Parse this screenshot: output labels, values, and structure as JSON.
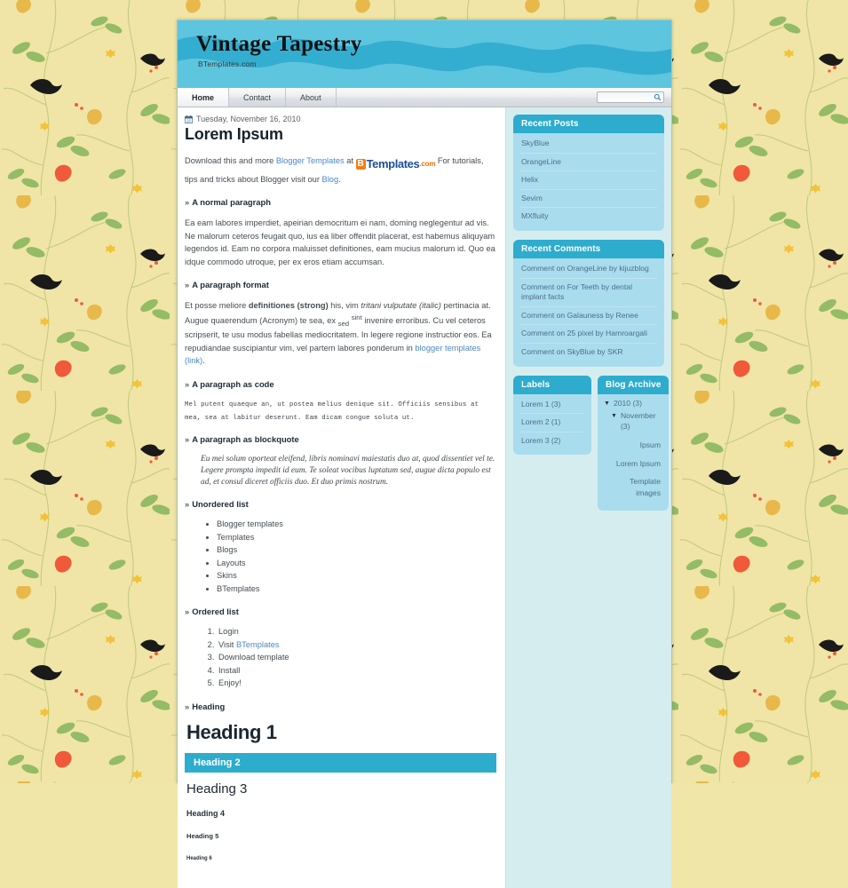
{
  "site": {
    "title": "Vintage Tapestry",
    "description": "BTemplates.com"
  },
  "nav": {
    "tabs": [
      {
        "label": "Home",
        "active": true
      },
      {
        "label": "Contact",
        "active": false
      },
      {
        "label": "About",
        "active": false
      }
    ],
    "search": {
      "value": "",
      "placeholder": "",
      "icon": "search-icon"
    }
  },
  "post": {
    "date": "Tuesday, November 16, 2010",
    "date_icon": "calendar-icon",
    "title": "Lorem Ipsum",
    "intro_before_link": "Download this and more ",
    "intro_link": "Blogger Templates",
    "intro_at": " at ",
    "logo": {
      "b": "B",
      "name": "Templates",
      "com": ".com"
    },
    "intro_after_logo": " For tutorials, tips and tricks about Blogger visit our ",
    "intro_blog_link": "Blog",
    "intro_end": ".",
    "sections": {
      "normal_paragraph_heading": "A normal paragraph",
      "normal_paragraph_text": "Ea eam labores imperdiet, apeirian democritum ei nam, doming neglegentur ad vis. Ne malorum ceteros feugait quo, ius ea liber offendit placerat, est habemus aliquyam legendos id. Eam no corpora maluisset definitiones, eam mucius malorum id. Quo ea idque commodo utroque, per ex eros etiam accumsan.",
      "format_heading": "A paragraph format",
      "format_p1": "Et posse meliore ",
      "format_strong": "definitiones (strong)",
      "format_p2": " his, vim ",
      "format_italic": "tritani vulputate (italic)",
      "format_p3": " pertinacia at. Augue quaerendum (Acronym) te sea, ex ",
      "format_sub": "sed",
      "format_sup": "sint",
      "format_strike": "invenire erroribus",
      "format_p4": ". Cu vel ceteros scripserit, te usu modus fabellas mediocritatem. In legere regione instructior eos. Ea repudiandae suscipiantur vim, vel partem labores ponderum in ",
      "format_link": "blogger templates (link)",
      "format_end": ".",
      "code_heading": "A paragraph as code",
      "code_text": "Mel putent quaeque an, ut postea melius denique sit. Officiis sensibus at mea, sea at labitur deserunt. Eam dicam congue soluta ut.",
      "blockquote_heading": "A paragraph as blockquote",
      "blockquote_text": "Eu mei solum oporteat eleifend, libris nominavi maiestatis duo at, quod dissentiet vel te. Legere prompta impedit id eum. Te soleat vocibus luptatum sed, augue dicta populo est ad, et consul diceret officiis duo. Et duo primis nostrum.",
      "unordered_heading": "Unordered list",
      "unordered_items": [
        "Blogger templates",
        "Templates",
        "Blogs",
        "Layouts",
        "Skins",
        "BTemplates"
      ],
      "ordered_heading": "Ordered list",
      "ordered_items": [
        {
          "text": "Login",
          "link": ""
        },
        {
          "text": "Visit ",
          "link": "BTemplates"
        },
        {
          "text": "Download template",
          "link": ""
        },
        {
          "text": "Install",
          "link": ""
        },
        {
          "text": "Enjoy!",
          "link": ""
        }
      ],
      "heading_heading": "Heading",
      "h1": "Heading 1",
      "h2": "Heading 2",
      "h3": "Heading 3",
      "h4": "Heading 4",
      "h5": "Heading 5",
      "h6": "Heading 6"
    }
  },
  "sidebar": {
    "recent_posts": {
      "title": "Recent Posts",
      "items": [
        "SkyBlue",
        "OrangeLine",
        "Helix",
        "Sevim",
        "MXfluity"
      ]
    },
    "recent_comments": {
      "title": "Recent Comments",
      "items": [
        "Comment on OrangeLine by kijuzblog",
        "Comment on For Teeth by dental implant facts",
        "Comment on Galauness by Renee",
        "Comment on 25 pixel by Hamroargali",
        "Comment on SkyBlue by SKR"
      ]
    },
    "labels": {
      "title": "Labels",
      "items": [
        "Lorem 1 (3)",
        "Lorem 2 (1)",
        "Lorem 3 (2)"
      ]
    },
    "blog_archive": {
      "title": "Blog Archive",
      "year": "2010 (3)",
      "month": "November (3)",
      "posts": [
        "Ipsum",
        "Lorem Ipsum",
        "Template images"
      ]
    }
  },
  "colors": {
    "header_light": "#5ec5de",
    "header_wave": "#2ba8cd",
    "accent": "#2eaccd",
    "widget_body": "#a9dced",
    "sidebar_bg": "#d6edf0",
    "page_bg": "#f0e6a8",
    "link": "#4a88c6",
    "logo_orange": "#f07d19",
    "logo_blue": "#1f4e99"
  }
}
